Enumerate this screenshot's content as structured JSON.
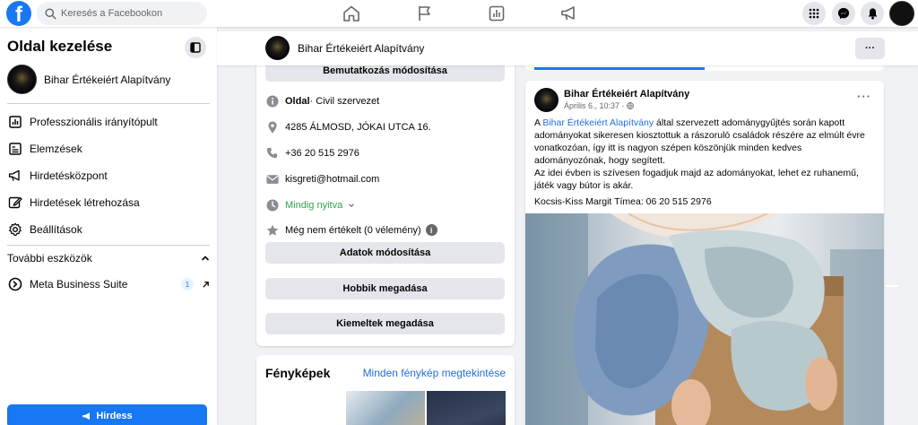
{
  "topbar": {
    "logo": "f",
    "search_placeholder": "Keresés a Facebookon",
    "nav_icons": [
      "home-icon",
      "flag-icon",
      "chart-icon",
      "megaphone-icon"
    ],
    "right_icons": [
      "menu-grid-icon",
      "messenger-icon",
      "bell-icon"
    ]
  },
  "sidebar": {
    "title": "Oldal kezelése",
    "page_name": "Bihar Értékeiért Alapítvány",
    "items": [
      {
        "label": "Professzionális irányítópult",
        "icon": "dashboard-icon"
      },
      {
        "label": "Elemzések",
        "icon": "insights-icon"
      },
      {
        "label": "Hirdetésközpont",
        "icon": "megaphone-icon"
      },
      {
        "label": "Hirdetések létrehozása",
        "icon": "pencil-icon"
      },
      {
        "label": "Beállítások",
        "icon": "gear-icon"
      }
    ],
    "section_title": "További eszközök",
    "tools": [
      {
        "label": "Meta Business Suite",
        "badge": "1"
      }
    ],
    "promote_label": "Hirdess"
  },
  "header": {
    "page_name": "Bihar Értékeiért Alapítvány",
    "more": "···"
  },
  "intro": {
    "edit_intro_label": "Bemutatkozás módosítása",
    "category_bold": "Oldal",
    "category_rest": " · Civil szervezet",
    "address": "4285 ÁLMOSD, JÓKAI UTCA 16.",
    "phone": "+36 20 515 2976",
    "email": "kisgreti@hotmail.com",
    "hours": "Mindig nyitva",
    "rating": "Még nem értékelt (0 vélemény)",
    "buttons": [
      "Adatok módosítása",
      "Hobbik megadása",
      "Kiemeltek megadása"
    ]
  },
  "photos": {
    "title": "Fényképek",
    "see_all": "Minden fénykép megtekintése"
  },
  "post": {
    "author": "Bihar Értékeiért Alapítvány",
    "time": "Április 6., 10:37 ·",
    "text_prefix": "A ",
    "text_link": "Bihar Értékeiért Alapítvány",
    "text_body": " által szervezett adománygyűjtés során kapott adományokat sikeresen kiosztottuk a rászoruló családok részére az elmúlt évre vonatkozóan, így itt is nagyon szépen köszönjük minden kedves adományozónak, hogy segített.",
    "text_body2": "Az idei évben is szívesen fogadjuk majd az adományokat, lehet ez ruhanemű, játék vagy bútor is akár.",
    "contact": "Kocsis-Kiss Margit Tímea: 06 20 515 2976",
    "more": "···"
  },
  "colors": {
    "accent": "#1877f2",
    "link": "#216fdb",
    "green": "#31a24c",
    "background": "#f0f2f5"
  }
}
